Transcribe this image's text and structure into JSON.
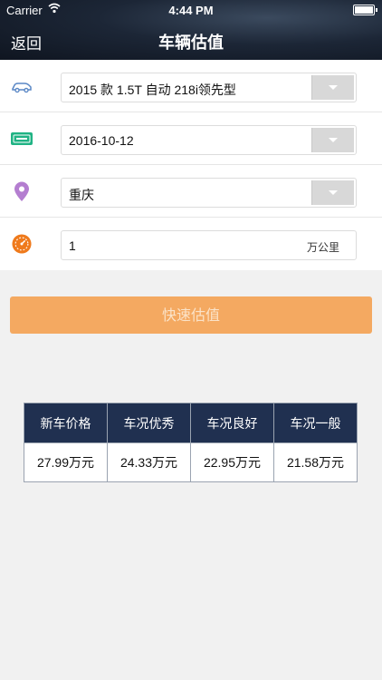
{
  "status_bar": {
    "carrier": "Carrier",
    "time": "4:44 PM"
  },
  "nav": {
    "back_label": "返回",
    "title": "车辆估值"
  },
  "form": {
    "model": {
      "icon": "car-icon",
      "value": "2015 款 1.5T 自动 218i领先型"
    },
    "date": {
      "icon": "license-plate-icon",
      "value": "2016-10-12"
    },
    "city": {
      "icon": "location-pin-icon",
      "value": "重庆"
    },
    "mileage": {
      "icon": "speedometer-icon",
      "value": "1",
      "unit": "万公里"
    }
  },
  "estimate_button": "快速估值",
  "result_table": {
    "headers": [
      "新车价格",
      "车况优秀",
      "车况良好",
      "车况一般"
    ],
    "values": [
      "27.99万元",
      "24.33万元",
      "22.95万元",
      "21.58万元"
    ]
  },
  "colors": {
    "button": "#f4a961",
    "table_header": "#203050",
    "icon_blue": "#5a87c5",
    "icon_green": "#20b384",
    "icon_purple": "#b47ed0",
    "icon_orange": "#ef7a1c"
  }
}
